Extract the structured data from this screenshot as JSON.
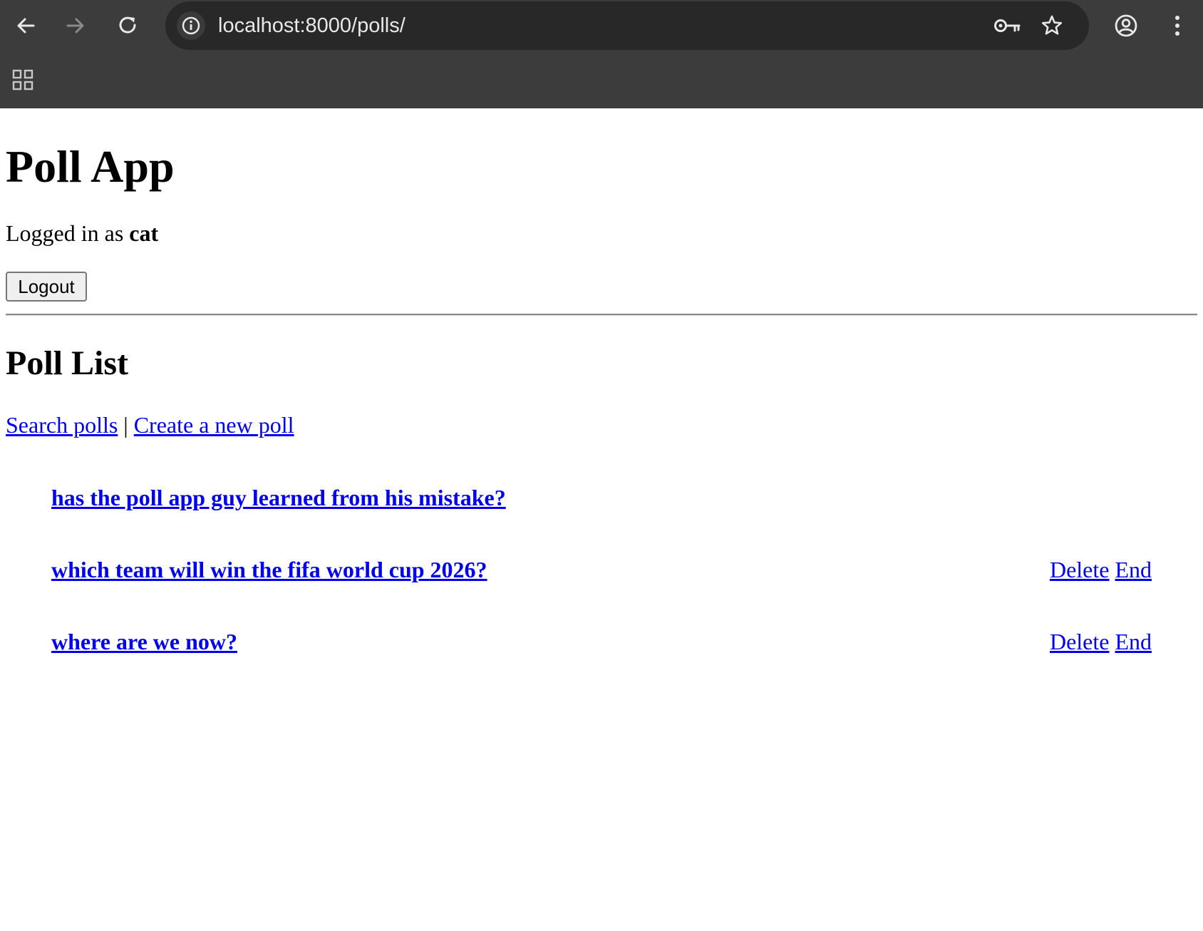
{
  "browser": {
    "url": "localhost:8000/polls/",
    "back_icon": "arrow-left-icon",
    "forward_icon": "arrow-right-icon",
    "reload_icon": "reload-icon",
    "info_icon": "info-icon",
    "key_icon": "key-icon",
    "star_icon": "star-icon",
    "profile_icon": "profile-icon",
    "menu_icon": "kebab-menu-icon",
    "apps_icon": "apps-grid-icon",
    "colors": {
      "toolbar": "#3c3c3c",
      "omnibox": "#282828",
      "icon": "#e8e8e8",
      "icon_disabled": "#8a8a8a"
    }
  },
  "page": {
    "title": "Poll App",
    "logged_in_prefix": "Logged in as ",
    "username": "cat",
    "logout_label": "Logout",
    "section_title": "Poll List",
    "search_link": "Search polls",
    "separator": "|",
    "create_link": "Create a new poll",
    "link_color": "#0000ee",
    "polls": [
      {
        "title": "has the poll app guy learned from his mistake?",
        "delete_label": "",
        "end_label": ""
      },
      {
        "title": "which team will win the fifa world cup 2026?",
        "delete_label": "Delete",
        "end_label": "End"
      },
      {
        "title": "where are we now?",
        "delete_label": "Delete",
        "end_label": "End"
      }
    ]
  }
}
